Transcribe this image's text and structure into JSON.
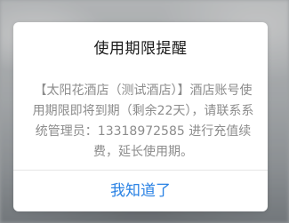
{
  "dialog": {
    "title": "使用期限提醒",
    "message": "【太阳花酒店（测试酒店）】酒店账号使用期限即将到期（剩余22天），请联系系统管理员：13318972585 进行充值续费，延长使用期。",
    "confirm_label": "我知道了",
    "accent_color": "#2a82e4"
  }
}
